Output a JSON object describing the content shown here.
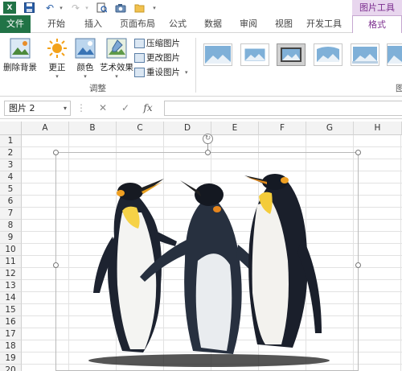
{
  "context_tab_header": "图片工具",
  "tabs": {
    "file": "文件",
    "home": "开始",
    "insert": "插入",
    "page_layout": "页面布局",
    "formulas": "公式",
    "data": "数据",
    "review": "审阅",
    "view": "视图",
    "developer": "开发工具",
    "format": "格式"
  },
  "ribbon": {
    "remove_background": "删除背景",
    "corrections": "更正",
    "color": "颜色",
    "artistic_effects": "艺术效果",
    "compress_pictures": "压缩图片",
    "change_picture": "更改图片",
    "reset_picture": "重设图片",
    "group_adjust": "调整",
    "group_styles_partial": "图"
  },
  "formula_bar": {
    "name_box": "图片 2",
    "fx": "fx",
    "value": ""
  },
  "columns": [
    "A",
    "B",
    "C",
    "D",
    "E",
    "F",
    "G",
    "H"
  ],
  "rows": [
    "1",
    "2",
    "3",
    "4",
    "5",
    "6",
    "7",
    "8",
    "9",
    "10",
    "11",
    "12",
    "13",
    "14",
    "15",
    "16",
    "17",
    "18",
    "19",
    "20"
  ],
  "colors": {
    "excel_green": "#217346",
    "picture_tools_purple": "#7b2d8e",
    "context_header_bg": "#e8d6ee"
  }
}
